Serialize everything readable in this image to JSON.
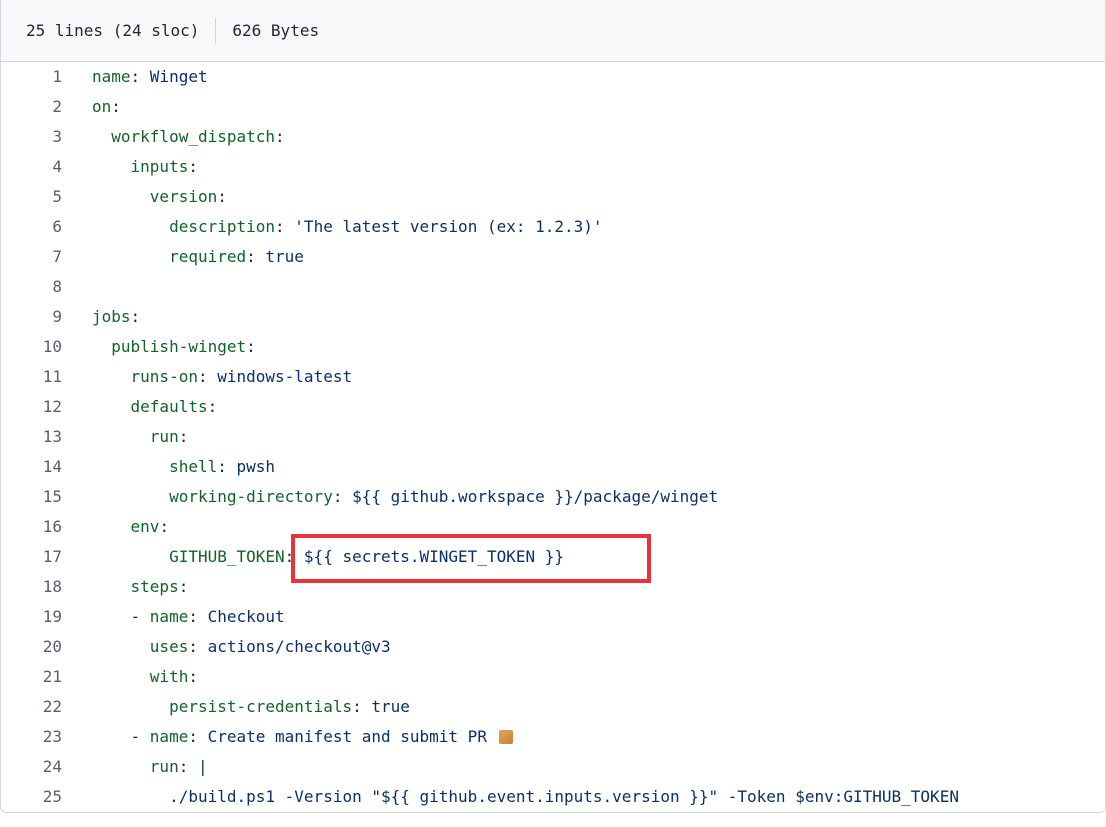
{
  "header": {
    "lines": "25 lines (24 sloc)",
    "size": "626 Bytes"
  },
  "code": {
    "lines": [
      {
        "n": "1",
        "indent": "",
        "key": "name",
        "sep": ": ",
        "val": "Winget"
      },
      {
        "n": "2",
        "indent": "",
        "key": "on",
        "sep": ":",
        "val": ""
      },
      {
        "n": "3",
        "indent": "  ",
        "key": "workflow_dispatch",
        "sep": ":",
        "val": ""
      },
      {
        "n": "4",
        "indent": "    ",
        "key": "inputs",
        "sep": ":",
        "val": ""
      },
      {
        "n": "5",
        "indent": "      ",
        "key": "version",
        "sep": ":",
        "val": ""
      },
      {
        "n": "6",
        "indent": "        ",
        "key": "description",
        "sep": ": ",
        "val": "'The latest version (ex: 1.2.3)'"
      },
      {
        "n": "7",
        "indent": "        ",
        "key": "required",
        "sep": ": ",
        "val": "true"
      },
      {
        "n": "8",
        "indent": "",
        "key": "",
        "sep": "",
        "val": ""
      },
      {
        "n": "9",
        "indent": "",
        "key": "jobs",
        "sep": ":",
        "val": ""
      },
      {
        "n": "10",
        "indent": "  ",
        "key": "publish-winget",
        "sep": ":",
        "val": ""
      },
      {
        "n": "11",
        "indent": "    ",
        "key": "runs-on",
        "sep": ": ",
        "val": "windows-latest"
      },
      {
        "n": "12",
        "indent": "    ",
        "key": "defaults",
        "sep": ":",
        "val": ""
      },
      {
        "n": "13",
        "indent": "      ",
        "key": "run",
        "sep": ":",
        "val": ""
      },
      {
        "n": "14",
        "indent": "        ",
        "key": "shell",
        "sep": ": ",
        "val": "pwsh"
      },
      {
        "n": "15",
        "indent": "        ",
        "key": "working-directory",
        "sep": ": ",
        "val": "${{ github.workspace }}/package/winget"
      },
      {
        "n": "16",
        "indent": "    ",
        "key": "env",
        "sep": ":",
        "val": ""
      },
      {
        "n": "17",
        "indent": "        ",
        "key": "GITHUB_TOKEN",
        "sep": ": ",
        "val": "${{ secrets.WINGET_TOKEN }}"
      },
      {
        "n": "18",
        "indent": "    ",
        "key": "steps",
        "sep": ":",
        "val": ""
      },
      {
        "n": "19",
        "indent": "    - ",
        "key": "name",
        "sep": ": ",
        "val": "Checkout"
      },
      {
        "n": "20",
        "indent": "      ",
        "key": "uses",
        "sep": ": ",
        "val": "actions/checkout@v3"
      },
      {
        "n": "21",
        "indent": "      ",
        "key": "with",
        "sep": ":",
        "val": ""
      },
      {
        "n": "22",
        "indent": "        ",
        "key": "persist-credentials",
        "sep": ": ",
        "val": "true"
      },
      {
        "n": "23",
        "indent": "    - ",
        "key": "name",
        "sep": ": ",
        "val": "Create manifest and submit PR",
        "emoji": true
      },
      {
        "n": "24",
        "indent": "      ",
        "key": "run",
        "sep": ": ",
        "val": "|"
      },
      {
        "n": "25",
        "indent": "        ",
        "key": "",
        "sep": "",
        "val": "./build.ps1 -Version \"${{ github.event.inputs.version }}\" -Token $env:GITHUB_TOKEN"
      }
    ]
  },
  "colors": {
    "highlight": "#e8333a",
    "key": "#116329",
    "value": "#0a3069"
  }
}
